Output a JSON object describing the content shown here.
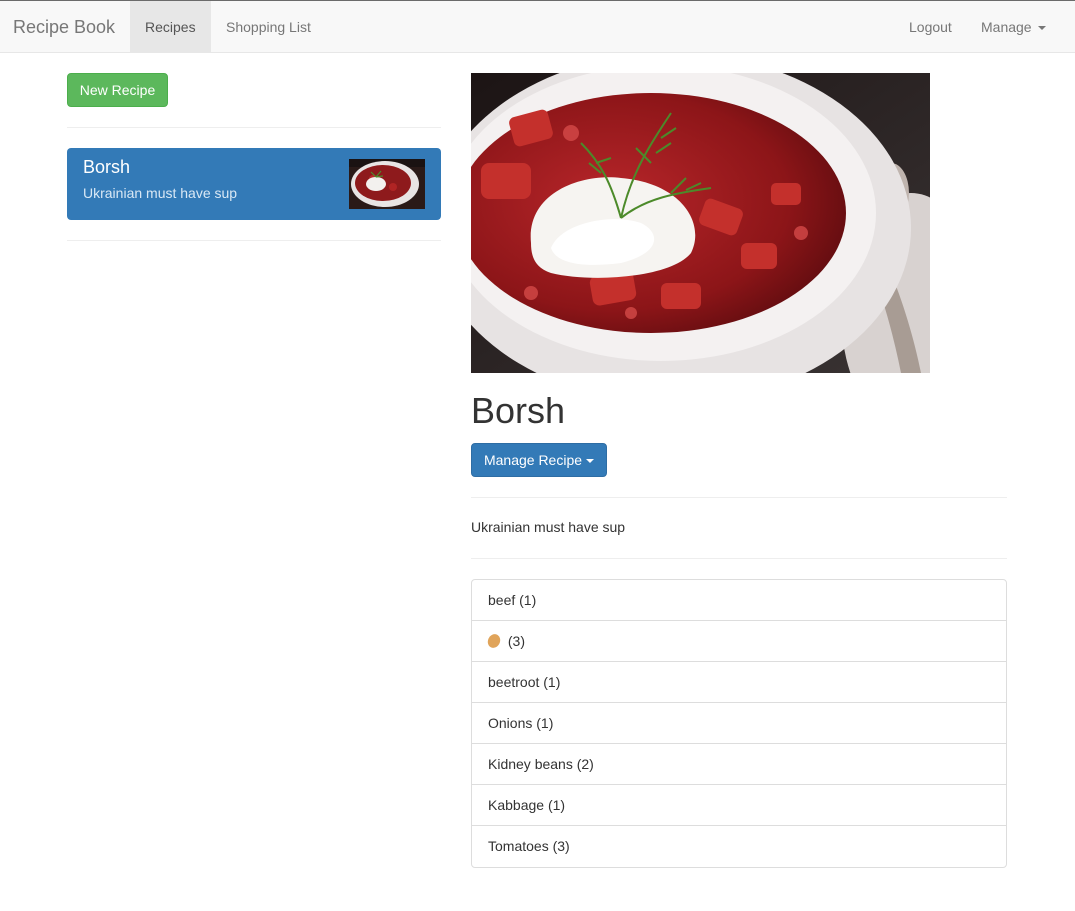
{
  "navbar": {
    "brand": "Recipe Book",
    "links": [
      {
        "label": "Recipes",
        "active": true
      },
      {
        "label": "Shopping List",
        "active": false
      }
    ],
    "logout": "Logout",
    "manage": "Manage"
  },
  "sidebar": {
    "new_recipe_label": "New Recipe",
    "recipes": [
      {
        "name": "Borsh",
        "description": "Ukrainian must have sup"
      }
    ]
  },
  "detail": {
    "name": "Borsh",
    "manage_label": "Manage Recipe",
    "description": "Ukrainian must have sup",
    "ingredients": [
      {
        "label": "beef (1)",
        "icon": ""
      },
      {
        "label": "(3)",
        "icon": "potato-icon"
      },
      {
        "label": "beetroot (1)",
        "icon": ""
      },
      {
        "label": "Onions (1)",
        "icon": ""
      },
      {
        "label": "Kidney beans (2)",
        "icon": ""
      },
      {
        "label": "Kabbage (1)",
        "icon": ""
      },
      {
        "label": "Tomatoes (3)",
        "icon": ""
      }
    ]
  },
  "colors": {
    "success": "#5cb85c",
    "primary": "#337ab7",
    "navbar_bg": "#f8f8f8"
  }
}
